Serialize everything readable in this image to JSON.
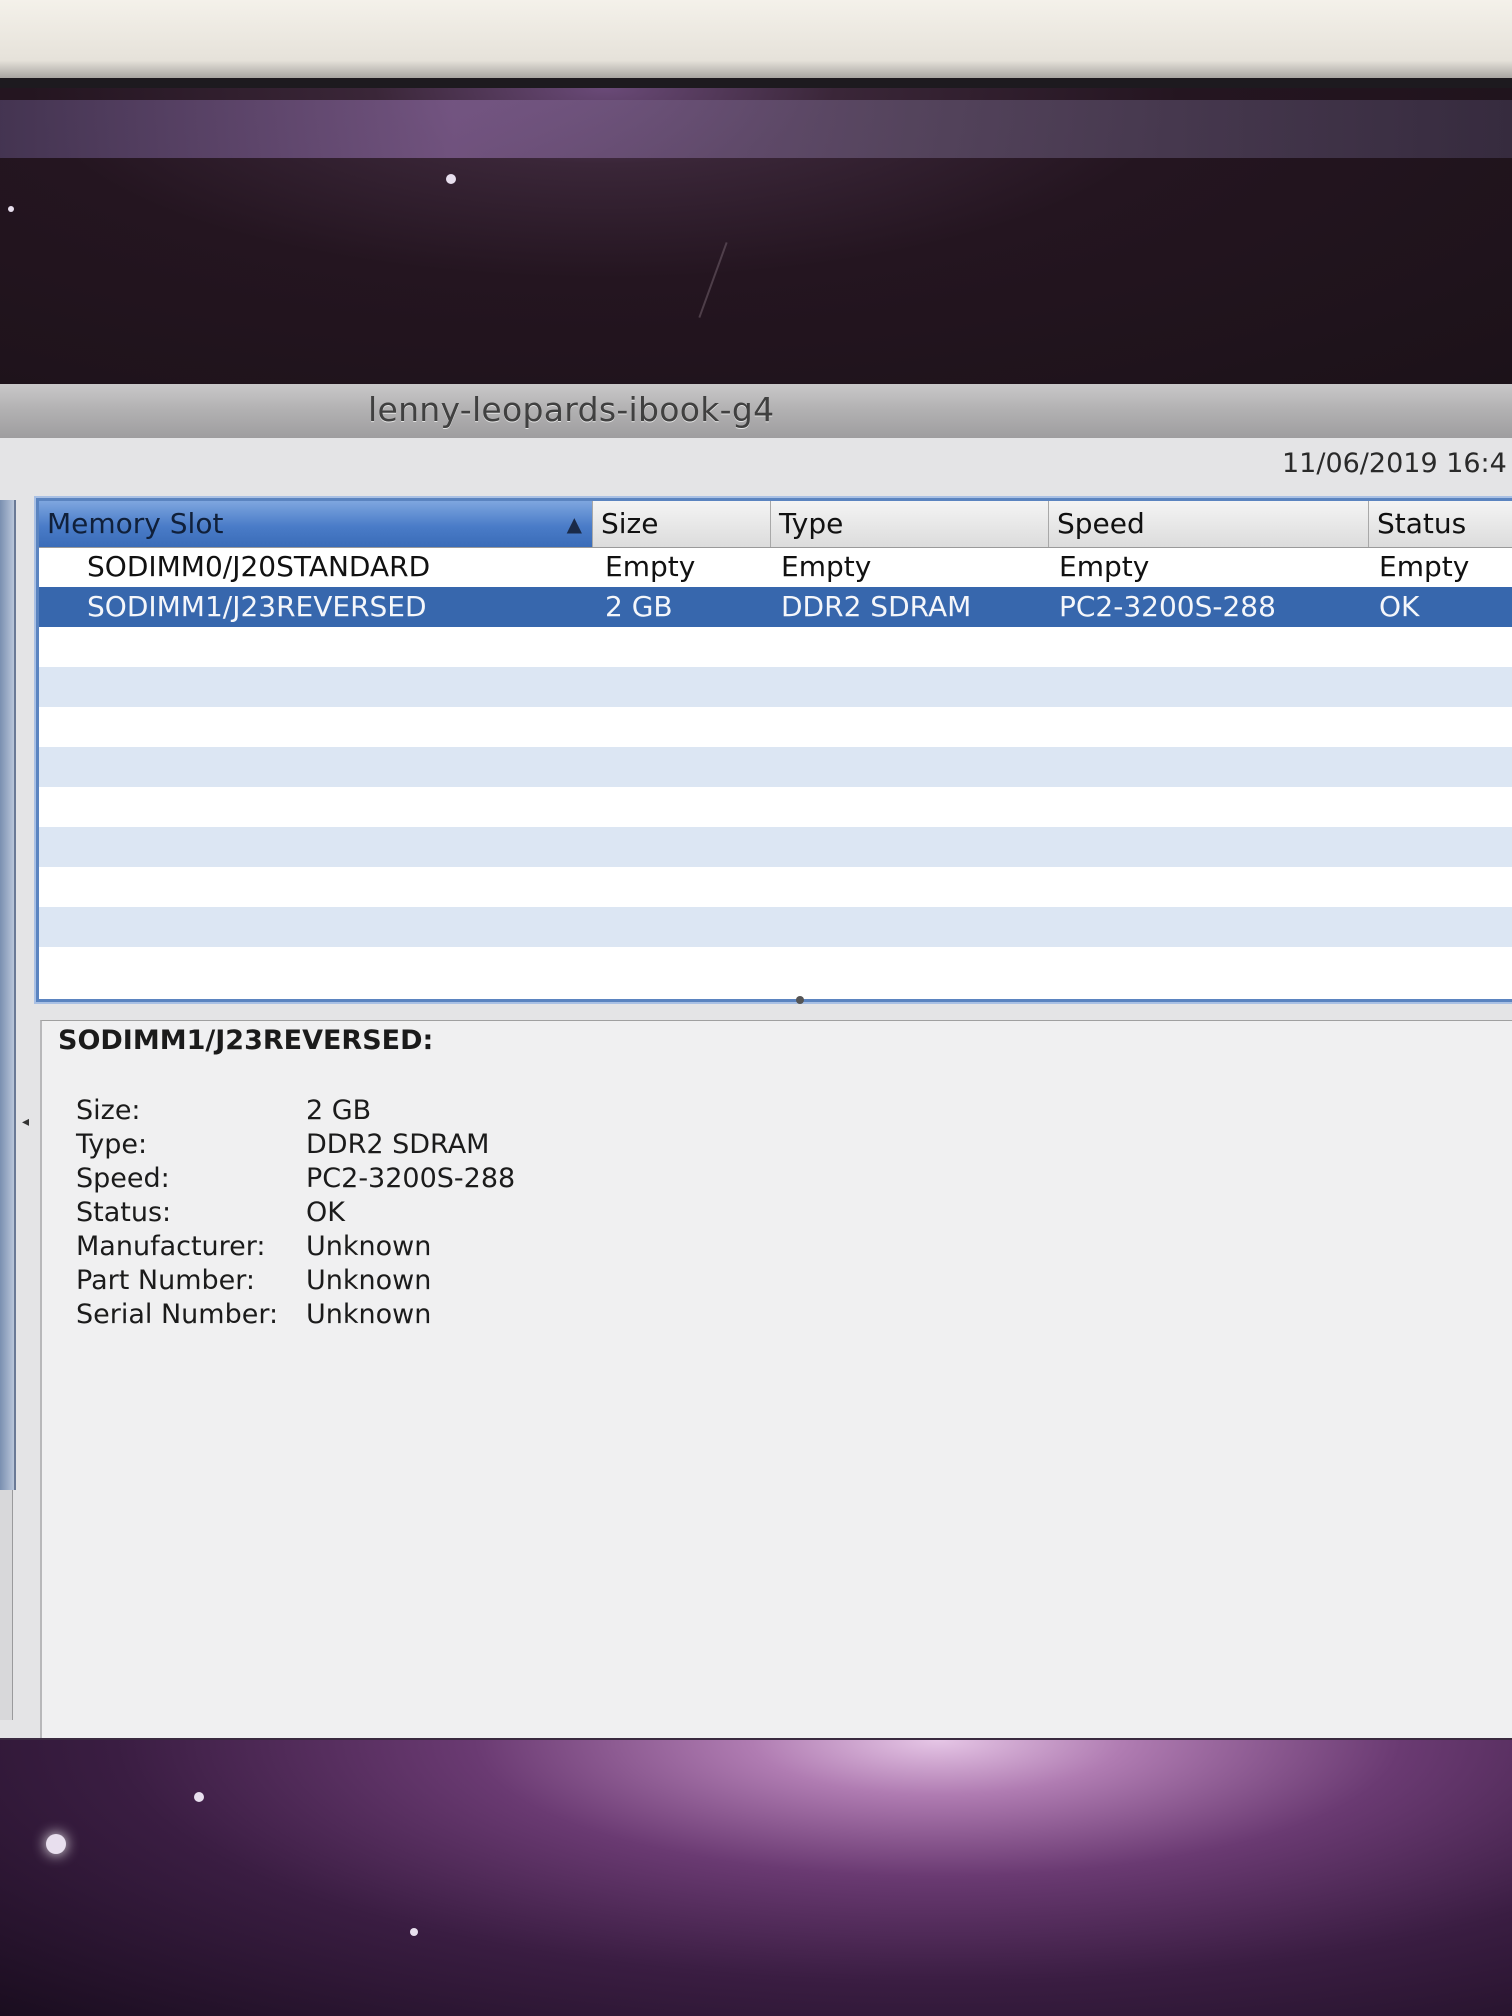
{
  "window": {
    "title": "lenny-leopards-ibook-g4",
    "timestamp": "11/06/2019 16:4"
  },
  "table": {
    "columns": [
      {
        "label": "Memory Slot",
        "sorted": true
      },
      {
        "label": "Size"
      },
      {
        "label": "Type"
      },
      {
        "label": "Speed"
      },
      {
        "label": "Status"
      }
    ],
    "rows": [
      {
        "slot": "SODIMM0/J20STANDARD",
        "size": "Empty",
        "type": "Empty",
        "speed": "Empty",
        "status": "Empty"
      },
      {
        "slot": "SODIMM1/J23REVERSED",
        "size": "2 GB",
        "type": "DDR2 SDRAM",
        "speed": "PC2-3200S-288",
        "status": "OK",
        "selected": true
      }
    ]
  },
  "detail": {
    "heading": "SODIMM1/J23REVERSED:",
    "fields": [
      {
        "label": "Size:",
        "value": "2 GB"
      },
      {
        "label": "Type:",
        "value": "DDR2 SDRAM"
      },
      {
        "label": "Speed:",
        "value": "PC2-3200S-288"
      },
      {
        "label": "Status:",
        "value": "OK"
      },
      {
        "label": "Manufacturer:",
        "value": "Unknown"
      },
      {
        "label": "Part Number:",
        "value": "Unknown"
      },
      {
        "label": "Serial Number:",
        "value": "Unknown"
      }
    ]
  },
  "colors": {
    "selection": "#3767ad",
    "stripe": "#dce6f3",
    "sorted_header": "#4a7cc8"
  },
  "icons": [
    "sort-ascending-icon"
  ]
}
